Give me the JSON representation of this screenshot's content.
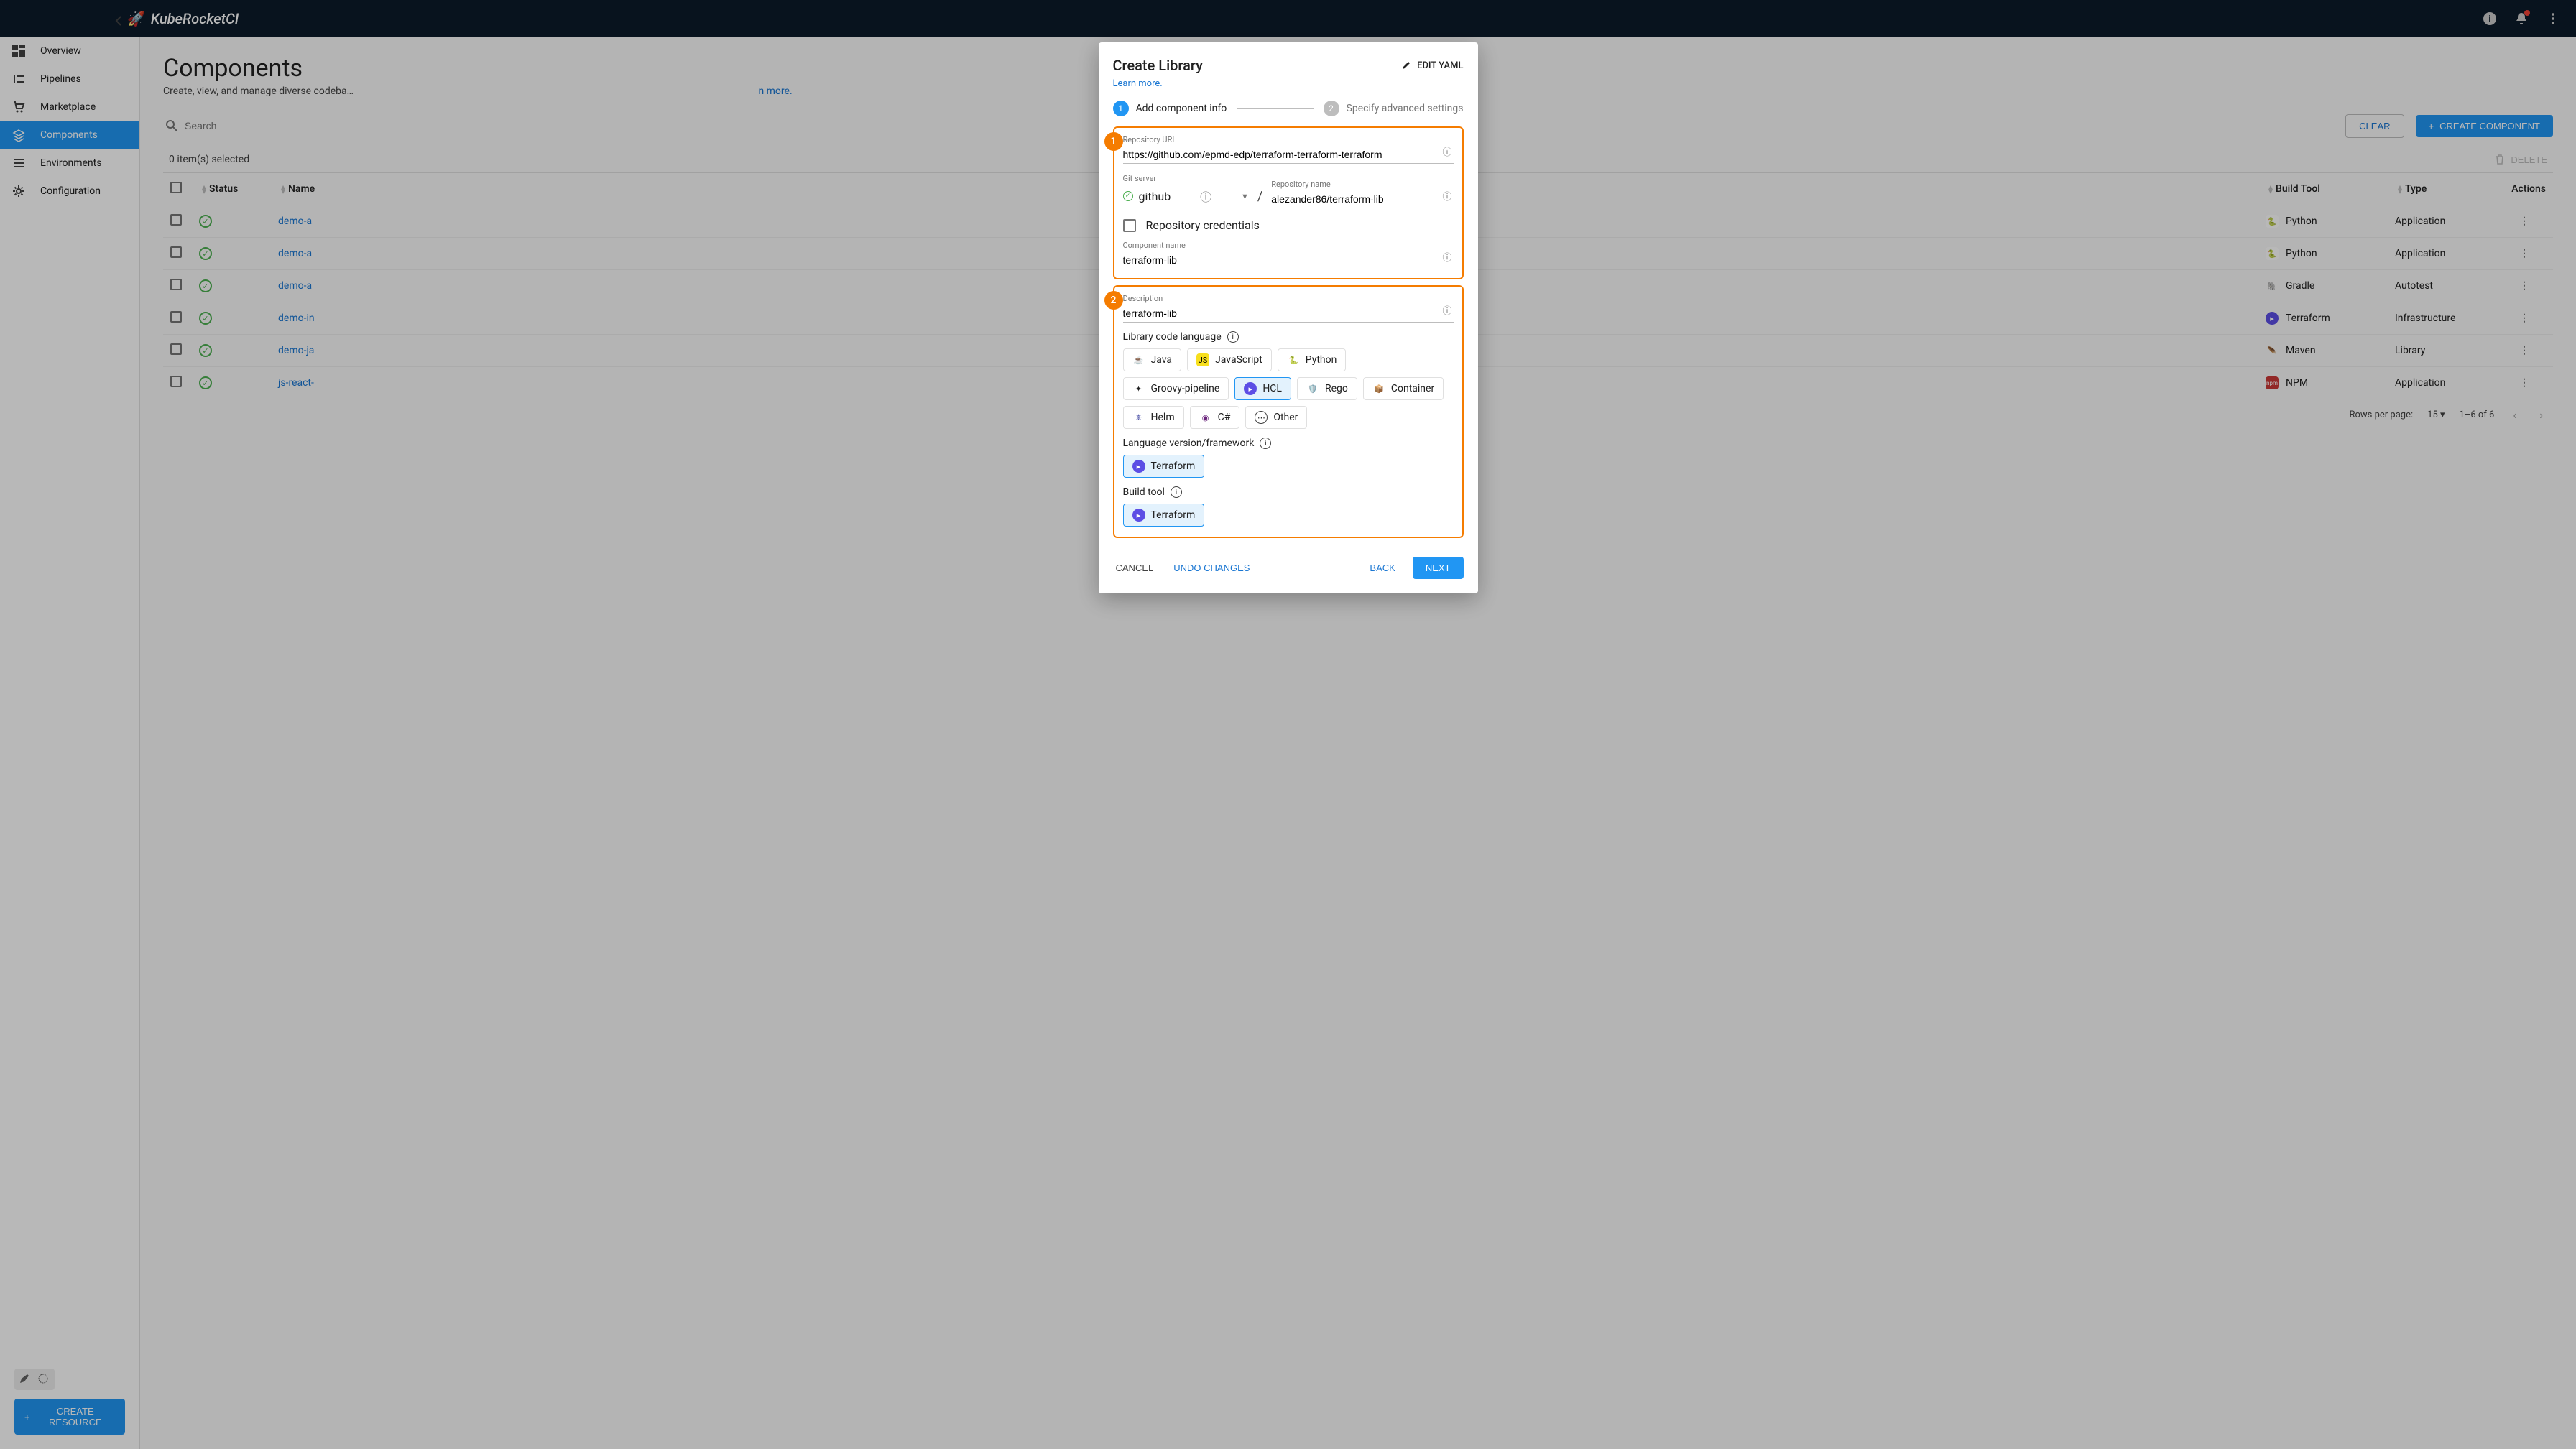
{
  "header": {
    "brand": "KubeRocketCI"
  },
  "sidebar": {
    "items": [
      {
        "label": "Overview",
        "icon": "dashboard"
      },
      {
        "label": "Pipelines",
        "icon": "pipelines"
      },
      {
        "label": "Marketplace",
        "icon": "cart"
      },
      {
        "label": "Components",
        "icon": "layers",
        "active": true
      },
      {
        "label": "Environments",
        "icon": "list"
      },
      {
        "label": "Configuration",
        "icon": "gear"
      }
    ],
    "create_resource": "CREATE RESOURCE"
  },
  "page": {
    "title": "Components",
    "subtitle_prefix": "Create, view, and manage diverse codeba",
    "subtitle_suffix_link": "n more.",
    "search_placeholder": "Search",
    "clear": "CLEAR",
    "create_component": "CREATE COMPONENT",
    "selected_text": "0 item(s) selected",
    "delete": "DELETE",
    "columns": {
      "status": "Status",
      "name": "Name",
      "build_tool": "Build Tool",
      "type": "Type",
      "actions": "Actions"
    },
    "rows": [
      {
        "name": "demo-a",
        "build_tool": "Python",
        "bt_icon": "python",
        "type": "Application"
      },
      {
        "name": "demo-a",
        "build_tool": "Python",
        "bt_icon": "python",
        "type": "Application"
      },
      {
        "name": "demo-a",
        "build_tool": "Gradle",
        "bt_icon": "gradle",
        "type": "Autotest"
      },
      {
        "name": "demo-in",
        "build_tool": "Terraform",
        "bt_icon": "terraform",
        "type": "Infrastructure"
      },
      {
        "name": "demo-ja",
        "build_tool": "Maven",
        "bt_icon": "maven",
        "type": "Library"
      },
      {
        "name": "js-react-",
        "build_tool": "NPM",
        "bt_icon": "npm",
        "type": "Application"
      }
    ],
    "pagination": {
      "rows_per_page_label": "Rows per page:",
      "rows_per_page_value": "15",
      "range": "1–6 of 6"
    }
  },
  "dialog": {
    "title": "Create Library",
    "edit_yaml": "EDIT YAML",
    "learn_more": "Learn more.",
    "step1_label": "Add component info",
    "step2_label": "Specify advanced settings",
    "annotation1": "1",
    "annotation2": "2",
    "repo_url_label": "Repository URL",
    "repo_url_value": "https://github.com/epmd-edp/terraform-terraform-terraform",
    "git_server_label": "Git server",
    "git_server_value": "github",
    "slash": "/",
    "repo_name_label": "Repository name",
    "repo_name_value": "alezander86/terraform-lib",
    "repo_credentials": "Repository credentials",
    "component_name_label": "Component name",
    "component_name_value": "terraform-lib",
    "description_label": "Description",
    "description_value": "terraform-lib",
    "language_label": "Library code language",
    "languages": [
      {
        "label": "Java",
        "icon": "java"
      },
      {
        "label": "JavaScript",
        "icon": "js"
      },
      {
        "label": "Python",
        "icon": "python"
      },
      {
        "label": "Groovy-pipeline",
        "icon": "groovy"
      },
      {
        "label": "HCL",
        "icon": "terraform",
        "selected": true
      },
      {
        "label": "Rego",
        "icon": "rego"
      },
      {
        "label": "Container",
        "icon": "container"
      },
      {
        "label": "Helm",
        "icon": "helm"
      },
      {
        "label": "C#",
        "icon": "csharp"
      },
      {
        "label": "Other",
        "icon": "other"
      }
    ],
    "framework_label": "Language version/framework",
    "frameworks": [
      {
        "label": "Terraform",
        "icon": "terraform",
        "selected": true
      }
    ],
    "build_tool_label": "Build tool",
    "build_tools": [
      {
        "label": "Terraform",
        "icon": "terraform",
        "selected": true
      }
    ],
    "footer": {
      "cancel": "CANCEL",
      "undo": "UNDO CHANGES",
      "back": "BACK",
      "next": "NEXT"
    }
  }
}
